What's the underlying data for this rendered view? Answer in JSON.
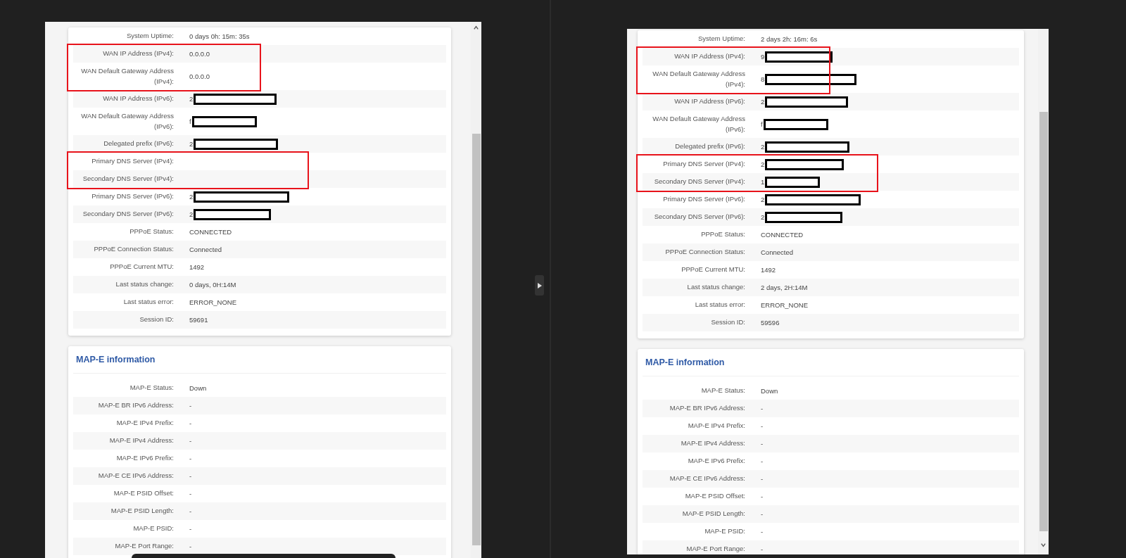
{
  "panes": [
    {
      "overlay_bar": true,
      "cards": [
        {
          "rows": [
            {
              "label": "System Uptime:",
              "value": "0 days 0h: 15m: 35s"
            },
            {
              "label": "WAN IP Address (IPv4):",
              "value": "0.0.0.0",
              "highlight": true
            },
            {
              "label": "WAN Default Gateway Address (IPv4):",
              "value": "0.0.0.0",
              "highlight": true
            },
            {
              "label": "WAN IP Address (IPv6):",
              "value": "2",
              "redacted": true
            },
            {
              "label": "WAN Default Gateway Address (IPv6):",
              "value": "f",
              "redacted": true
            },
            {
              "label": "Delegated prefix (IPv6):",
              "value": "2",
              "redacted": true
            },
            {
              "label": "Primary DNS Server (IPv4):",
              "highlight": true
            },
            {
              "label": "Secondary DNS Server (IPv4):",
              "highlight": true
            },
            {
              "label": "Primary DNS Server (IPv6):",
              "value": "2",
              "redacted": true
            },
            {
              "label": "Secondary DNS Server (IPv6):",
              "value": "2",
              "redacted": true
            },
            {
              "label": "PPPoE Status:",
              "value": "CONNECTED"
            },
            {
              "label": "PPPoE Connection Status:",
              "value": "Connected"
            },
            {
              "label": "PPPoE Current MTU:",
              "value": "1492"
            },
            {
              "label": "Last status change:",
              "value": "0 days, 0H:14M"
            },
            {
              "label": "Last status error:",
              "value": "ERROR_NONE"
            },
            {
              "label": "Session ID:",
              "value": "59691"
            }
          ]
        },
        {
          "title": "MAP-E information",
          "rows": [
            {
              "label": "MAP-E Status:",
              "value": "Down"
            },
            {
              "label": "MAP-E BR IPv6 Address:",
              "value": "-"
            },
            {
              "label": "MAP-E IPv4 Prefix:",
              "value": "-"
            },
            {
              "label": "MAP-E IPv4 Address:",
              "value": "-"
            },
            {
              "label": "MAP-E IPv6 Prefix:",
              "value": "-"
            },
            {
              "label": "MAP-E CE IPv6 Address:",
              "value": "-"
            },
            {
              "label": "MAP-E PSID Offset:",
              "value": "-"
            },
            {
              "label": "MAP-E PSID Length:",
              "value": "-"
            },
            {
              "label": "MAP-E PSID:",
              "value": "-"
            },
            {
              "label": "MAP-E Port Range:",
              "value": "-"
            }
          ]
        }
      ]
    },
    {
      "overlay_bar": false,
      "cards": [
        {
          "rows": [
            {
              "label": "System Uptime:",
              "value": "2 days 2h: 16m: 6s"
            },
            {
              "label": "WAN IP Address (IPv4):",
              "value": "9",
              "redacted": true,
              "highlight": true
            },
            {
              "label": "WAN Default Gateway Address (IPv4):",
              "value": "8",
              "redacted": true,
              "highlight": true
            },
            {
              "label": "WAN IP Address (IPv6):",
              "value": "2",
              "redacted": true
            },
            {
              "label": "WAN Default Gateway Address (IPv6):",
              "value": "f",
              "redacted": true
            },
            {
              "label": "Delegated prefix (IPv6):",
              "value": "2",
              "redacted": true
            },
            {
              "label": "Primary DNS Server (IPv4):",
              "value": "2",
              "redacted": true,
              "highlight": true
            },
            {
              "label": "Secondary DNS Server (IPv4):",
              "value": "1",
              "redacted": true,
              "highlight": true
            },
            {
              "label": "Primary DNS Server (IPv6):",
              "value": "2",
              "redacted": true
            },
            {
              "label": "Secondary DNS Server (IPv6):",
              "value": "2",
              "redacted": true
            },
            {
              "label": "PPPoE Status:",
              "value": "CONNECTED"
            },
            {
              "label": "PPPoE Connection Status:",
              "value": "Connected"
            },
            {
              "label": "PPPoE Current MTU:",
              "value": "1492"
            },
            {
              "label": "Last status change:",
              "value": "2 days, 2H:14M"
            },
            {
              "label": "Last status error:",
              "value": "ERROR_NONE"
            },
            {
              "label": "Session ID:",
              "value": "59596"
            }
          ]
        },
        {
          "title": "MAP-E information",
          "rows": [
            {
              "label": "MAP-E Status:",
              "value": "Down"
            },
            {
              "label": "MAP-E BR IPv6 Address:",
              "value": "-"
            },
            {
              "label": "MAP-E IPv4 Prefix:",
              "value": "-"
            },
            {
              "label": "MAP-E IPv4 Address:",
              "value": "-"
            },
            {
              "label": "MAP-E IPv6 Prefix:",
              "value": "-"
            },
            {
              "label": "MAP-E CE IPv6 Address:",
              "value": "-"
            },
            {
              "label": "MAP-E PSID Offset:",
              "value": "-"
            },
            {
              "label": "MAP-E PSID Length:",
              "value": "-"
            },
            {
              "label": "MAP-E PSID:",
              "value": "-"
            },
            {
              "label": "MAP-E Port Range:",
              "value": "-"
            }
          ]
        }
      ]
    }
  ]
}
